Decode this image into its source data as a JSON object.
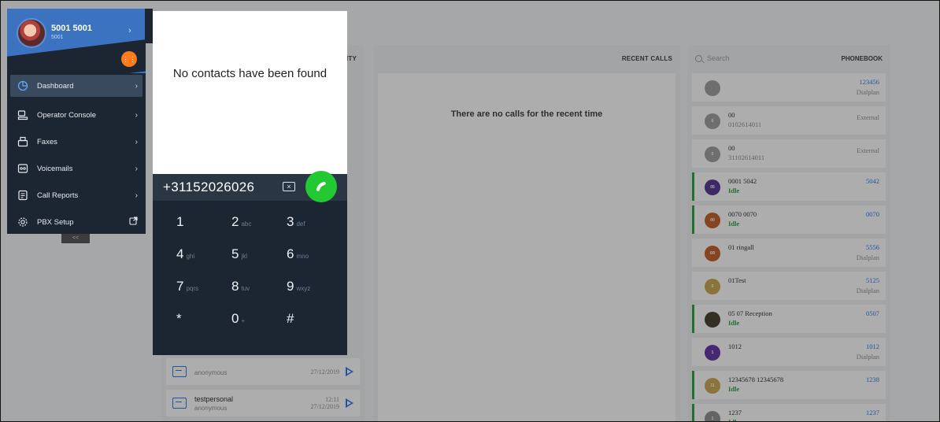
{
  "sidebar": {
    "user_name": "5001 5001",
    "user_ext": "5001",
    "collapse_label": "<<",
    "items": [
      {
        "label": "Dashboard",
        "icon": "pie-chart-icon",
        "active": true
      },
      {
        "label": "Operator Console",
        "icon": "operator-icon"
      },
      {
        "label": "Faxes",
        "icon": "fax-icon"
      },
      {
        "label": "Voicemails",
        "icon": "voicemail-icon"
      },
      {
        "label": "Call Reports",
        "icon": "report-icon"
      },
      {
        "label": "PBX Setup",
        "icon": "gear-icon",
        "external": true
      }
    ]
  },
  "dialer": {
    "empty_message": "No contacts have been found",
    "number": "+31152026026",
    "keys": [
      [
        {
          "d": "1",
          "s": ""
        },
        {
          "d": "2",
          "s": "abc"
        },
        {
          "d": "3",
          "s": "def"
        }
      ],
      [
        {
          "d": "4",
          "s": "ghi"
        },
        {
          "d": "5",
          "s": "jkl"
        },
        {
          "d": "6",
          "s": "mno"
        }
      ],
      [
        {
          "d": "7",
          "s": "pqrs"
        },
        {
          "d": "8",
          "s": "tuv"
        },
        {
          "d": "9",
          "s": "wxyz"
        }
      ],
      [
        {
          "d": "*",
          "s": ""
        },
        {
          "d": "0",
          "s": "+"
        },
        {
          "d": "#",
          "s": ""
        }
      ]
    ]
  },
  "activity": {
    "header_suffix": "VITY",
    "items": [
      {
        "title": "",
        "sub": "anonymous",
        "time": "",
        "date": "27/12/2019"
      },
      {
        "title": "testpersonal",
        "sub": "anonymous",
        "time": "12:11",
        "date": "27/12/2019"
      }
    ]
  },
  "recent_calls": {
    "title": "RECENT CALLS",
    "empty_message": "There are no calls for the recent time"
  },
  "phonebook": {
    "title": "PHONEBOOK",
    "search_placeholder": "Search",
    "entries": [
      {
        "name": "",
        "sub": "",
        "number": "123456",
        "type": "Dialplan",
        "avatar": "",
        "color": "#9a9a9a",
        "idle": false
      },
      {
        "name": "00",
        "sub": "0102614011",
        "number": "",
        "type": "External",
        "avatar": "0",
        "color": "#9a9a9a",
        "idle": false
      },
      {
        "name": "00",
        "sub": "31102614011",
        "number": "",
        "type": "External",
        "avatar": "0",
        "color": "#9a9a9a",
        "idle": false
      },
      {
        "name": "0001 5042",
        "sub": "Idle",
        "number": "5042",
        "type": "",
        "avatar": "05",
        "color": "#4b2a8c",
        "idle": true
      },
      {
        "name": "0070 0070",
        "sub": "Idle",
        "number": "0070",
        "type": "",
        "avatar": "00",
        "color": "#c0561b",
        "idle": true
      },
      {
        "name": "01 ringall",
        "sub": "",
        "number": "5556",
        "type": "Dialplan",
        "avatar": "0R",
        "color": "#c0561b",
        "idle": false
      },
      {
        "name": "01Test",
        "sub": "",
        "number": "5125",
        "type": "Dialplan",
        "avatar": "0",
        "color": "#c9a24a",
        "idle": false
      },
      {
        "name": "05 07 Reception",
        "sub": "Idle",
        "number": "0507",
        "type": "",
        "avatar": "",
        "color": "#3b3420",
        "idle": true
      },
      {
        "name": "1012",
        "sub": "",
        "number": "1012",
        "type": "Dialplan",
        "avatar": "1",
        "color": "#5a2aa0",
        "idle": false
      },
      {
        "name": "12345678 12345678",
        "sub": "Idle",
        "number": "1238",
        "type": "",
        "avatar": "11",
        "color": "#c9a24a",
        "idle": true
      },
      {
        "name": "1237",
        "sub": "Idle",
        "number": "1237",
        "type": "",
        "avatar": "1",
        "color": "#8a8a8a",
        "idle": true
      }
    ]
  }
}
